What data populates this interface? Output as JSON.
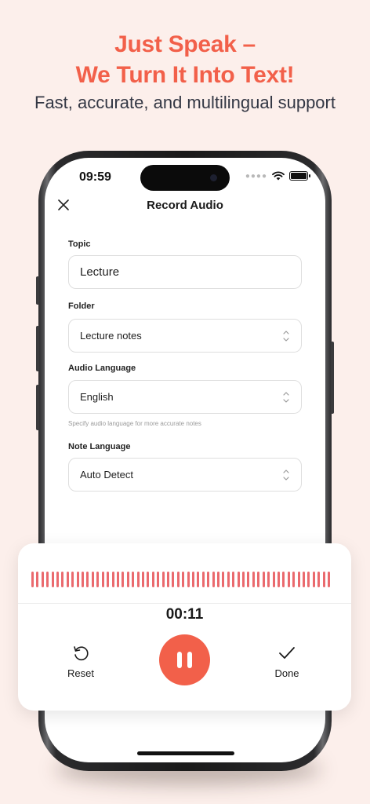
{
  "promo": {
    "headline_line1": "Just Speak –",
    "headline_line2": "We Turn It Into Text!",
    "subheadline": "Fast, accurate, and multilingual support"
  },
  "status_bar": {
    "time": "09:59",
    "icons": [
      "signal-dots-icon",
      "wifi-icon",
      "battery-icon"
    ]
  },
  "nav": {
    "title": "Record Audio",
    "close_icon": "close-icon"
  },
  "form": {
    "topic": {
      "label": "Topic",
      "value": "Lecture"
    },
    "folder": {
      "label": "Folder",
      "value": "Lecture notes"
    },
    "audio_language": {
      "label": "Audio Language",
      "value": "English",
      "hint": "Specify audio language for more accurate notes"
    },
    "note_language": {
      "label": "Note Language",
      "value": "Auto Detect"
    }
  },
  "recorder": {
    "timer": "00:11",
    "reset_label": "Reset",
    "done_label": "Done",
    "pause_icon": "pause-icon",
    "waveform_bar_count": 60
  },
  "colors": {
    "accent": "#f2604a",
    "waveform": "#ea6a6e",
    "background": "#fcefeb",
    "subheadline": "#333744"
  }
}
